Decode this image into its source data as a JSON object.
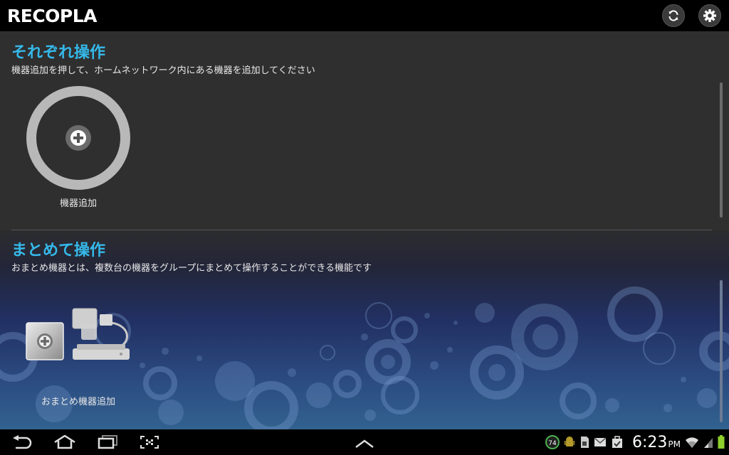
{
  "app": {
    "logo_text": "RECOPLA",
    "sync_icon": "sync-icon",
    "settings_icon": "gear-icon"
  },
  "individual_section": {
    "title": "それぞれ操作",
    "description": "機器追加を押して、ホームネットワーク内にある機器を追加してください",
    "add_device_label": "機器追加"
  },
  "group_section": {
    "title": "まとめて操作",
    "description": "おまとめ機器とは、複数台の機器をグループにまとめて操作することができる機能です",
    "add_group_label": "おまとめ機器追加"
  },
  "system_bar": {
    "nav_icons": [
      "back-icon",
      "home-icon",
      "recent-apps-icon",
      "screenshot-icon",
      "chevron-up-icon"
    ],
    "notification_badge": "74",
    "clock_time": "6:23",
    "clock_ampm": "PM"
  },
  "colors": {
    "accent": "#35b9ea",
    "panel_bg": "#2f2f2f",
    "battery": "#8fce2c"
  }
}
